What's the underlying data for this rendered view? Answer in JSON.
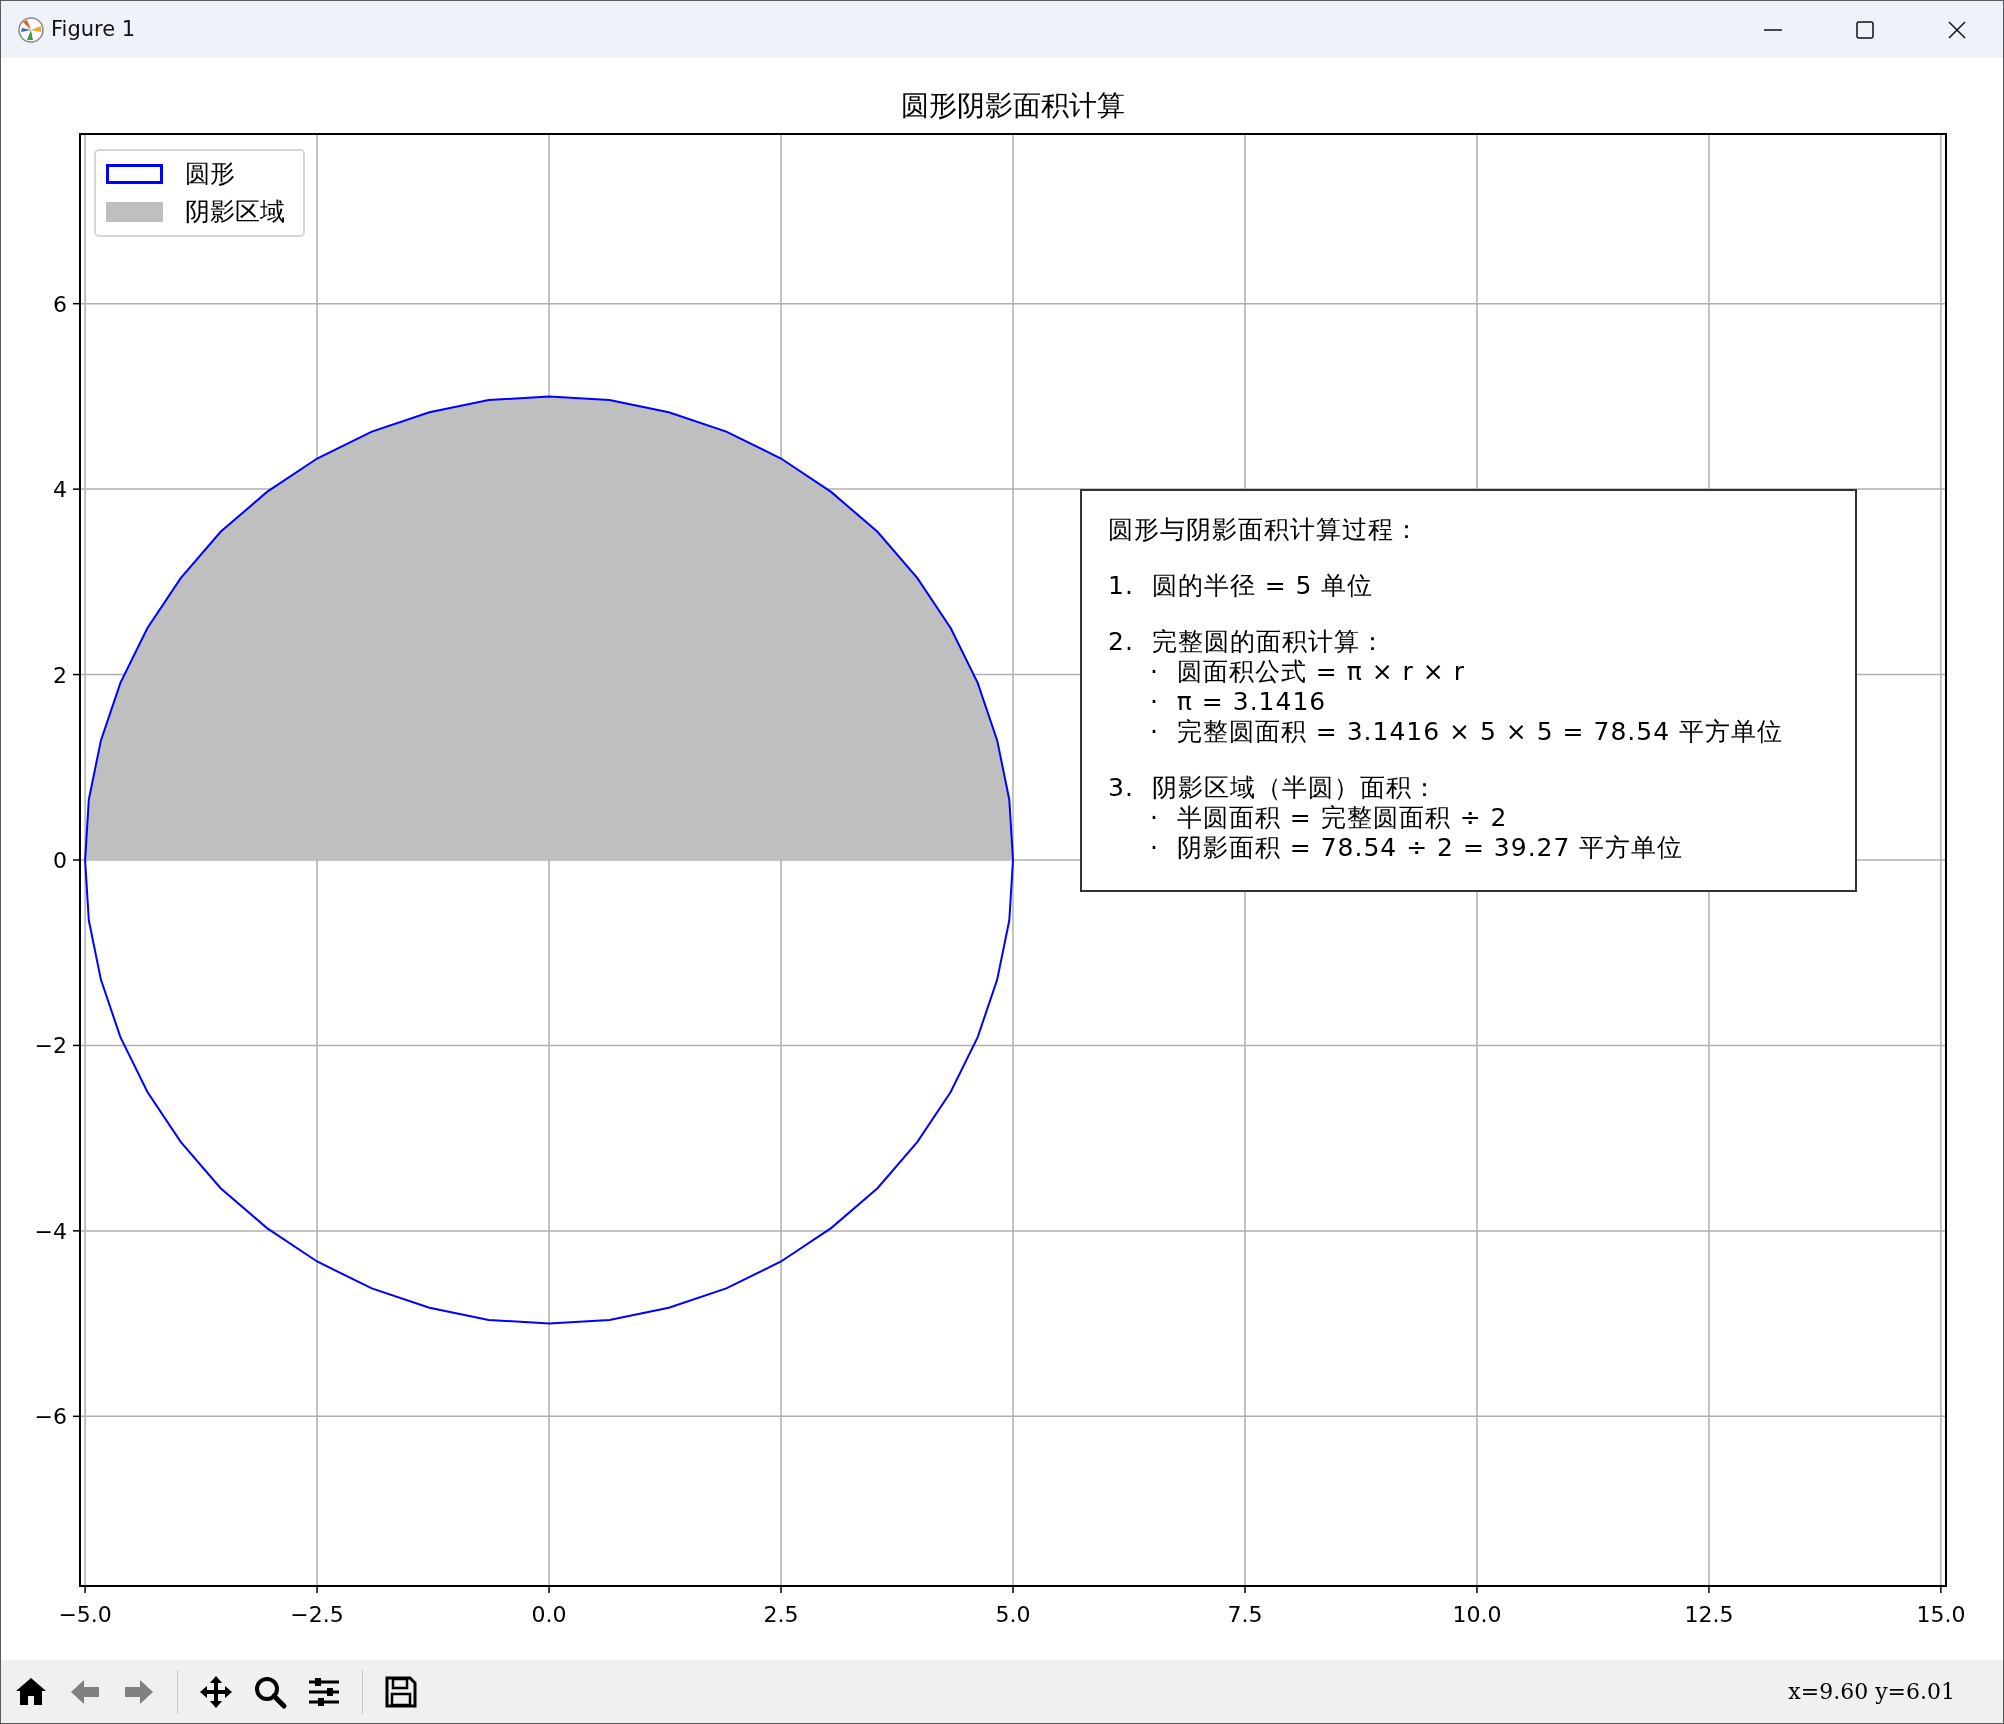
{
  "window": {
    "title": "Figure 1"
  },
  "figure": {
    "chart_data": {
      "type": "line",
      "title": "圆形阴影面积计算",
      "grid": true,
      "xlim": [
        -5.055,
        15.055
      ],
      "ylim": [
        -7.83,
        7.83
      ],
      "xticks": [
        {
          "value": -5,
          "label": "−5.0"
        },
        {
          "value": -2.5,
          "label": "−2.5"
        },
        {
          "value": 0,
          "label": "0.0"
        },
        {
          "value": 2.5,
          "label": "2.5"
        },
        {
          "value": 5,
          "label": "5.0"
        },
        {
          "value": 7.5,
          "label": "7.5"
        },
        {
          "value": 10,
          "label": "10.0"
        },
        {
          "value": 12.5,
          "label": "12.5"
        },
        {
          "value": 15,
          "label": "15.0"
        }
      ],
      "yticks": [
        {
          "value": -6,
          "label": "−6"
        },
        {
          "value": -4,
          "label": "−4"
        },
        {
          "value": -2,
          "label": "−2"
        },
        {
          "value": 0,
          "label": "0"
        },
        {
          "value": 2,
          "label": "2"
        },
        {
          "value": 4,
          "label": "4"
        },
        {
          "value": 6,
          "label": "6"
        }
      ],
      "series": [
        {
          "name": "圆形",
          "type": "line",
          "color": "#0000ff",
          "x": [
            -5,
            -4.96,
            -4.83,
            -4.62,
            -4.33,
            -3.97,
            -3.54,
            -3.04,
            -2.5,
            -1.91,
            -1.29,
            -0.65,
            0,
            0.65,
            1.29,
            1.91,
            2.5,
            3.04,
            3.54,
            3.97,
            4.33,
            4.62,
            4.83,
            4.96,
            5
          ],
          "values": [
            0,
            -0.65,
            -1.29,
            -1.91,
            -2.5,
            -3.04,
            -3.54,
            -3.97,
            -4.33,
            -4.62,
            -4.83,
            -4.96,
            -5,
            -4.96,
            -4.83,
            -4.62,
            -4.33,
            -3.97,
            -3.54,
            -3.04,
            -2.5,
            -1.91,
            -1.29,
            -0.65,
            0
          ]
        },
        {
          "name": "阴影区域",
          "type": "area",
          "color": "#bfbfbf",
          "x": [
            -5,
            -4.96,
            -4.83,
            -4.62,
            -4.33,
            -3.97,
            -3.54,
            -3.04,
            -2.5,
            -1.91,
            -1.29,
            -0.65,
            0,
            0.65,
            1.29,
            1.91,
            2.5,
            3.04,
            3.54,
            3.97,
            4.33,
            4.62,
            4.83,
            4.96,
            5
          ],
          "values": [
            0,
            0.65,
            1.29,
            1.91,
            2.5,
            3.04,
            3.54,
            3.97,
            4.33,
            4.62,
            4.83,
            4.96,
            5,
            4.96,
            4.83,
            4.62,
            4.33,
            3.97,
            3.54,
            3.04,
            2.5,
            1.91,
            1.29,
            0.65,
            0
          ]
        }
      ]
    },
    "text_box": {
      "lines": [
        {
          "kind": "heading",
          "text": "圆形与阴影面积计算过程："
        },
        {
          "kind": "step",
          "text": "1.  圆的半径 = 5 单位"
        },
        {
          "kind": "step",
          "text": "2.  完整圆的面积计算："
        },
        {
          "kind": "bullet",
          "text": "·  圆面积公式 = π × r × r"
        },
        {
          "kind": "bullet",
          "text": "·  π = 3.1416"
        },
        {
          "kind": "bullet",
          "text": "·  完整圆面积 = 3.1416 × 5 × 5 = 78.54 平方单位"
        },
        {
          "kind": "step",
          "text": "3.  阴影区域（半圆）面积："
        },
        {
          "kind": "bullet",
          "text": "·  半圆面积 = 完整圆面积 ÷ 2"
        },
        {
          "kind": "bullet",
          "text": "·  阴影面积 = 78.54 ÷ 2 = 39.27 平方单位"
        }
      ]
    }
  },
  "toolbar": {
    "buttons": [
      {
        "kind": "home",
        "disabled": false
      },
      {
        "kind": "back",
        "disabled": true
      },
      {
        "kind": "forward",
        "disabled": true
      },
      {
        "kind": "separator"
      },
      {
        "kind": "pan",
        "disabled": false
      },
      {
        "kind": "zoom",
        "disabled": false
      },
      {
        "kind": "configure",
        "disabled": false
      },
      {
        "kind": "separator"
      },
      {
        "kind": "save",
        "disabled": false
      }
    ],
    "status": "x=9.60 y=6.01"
  }
}
